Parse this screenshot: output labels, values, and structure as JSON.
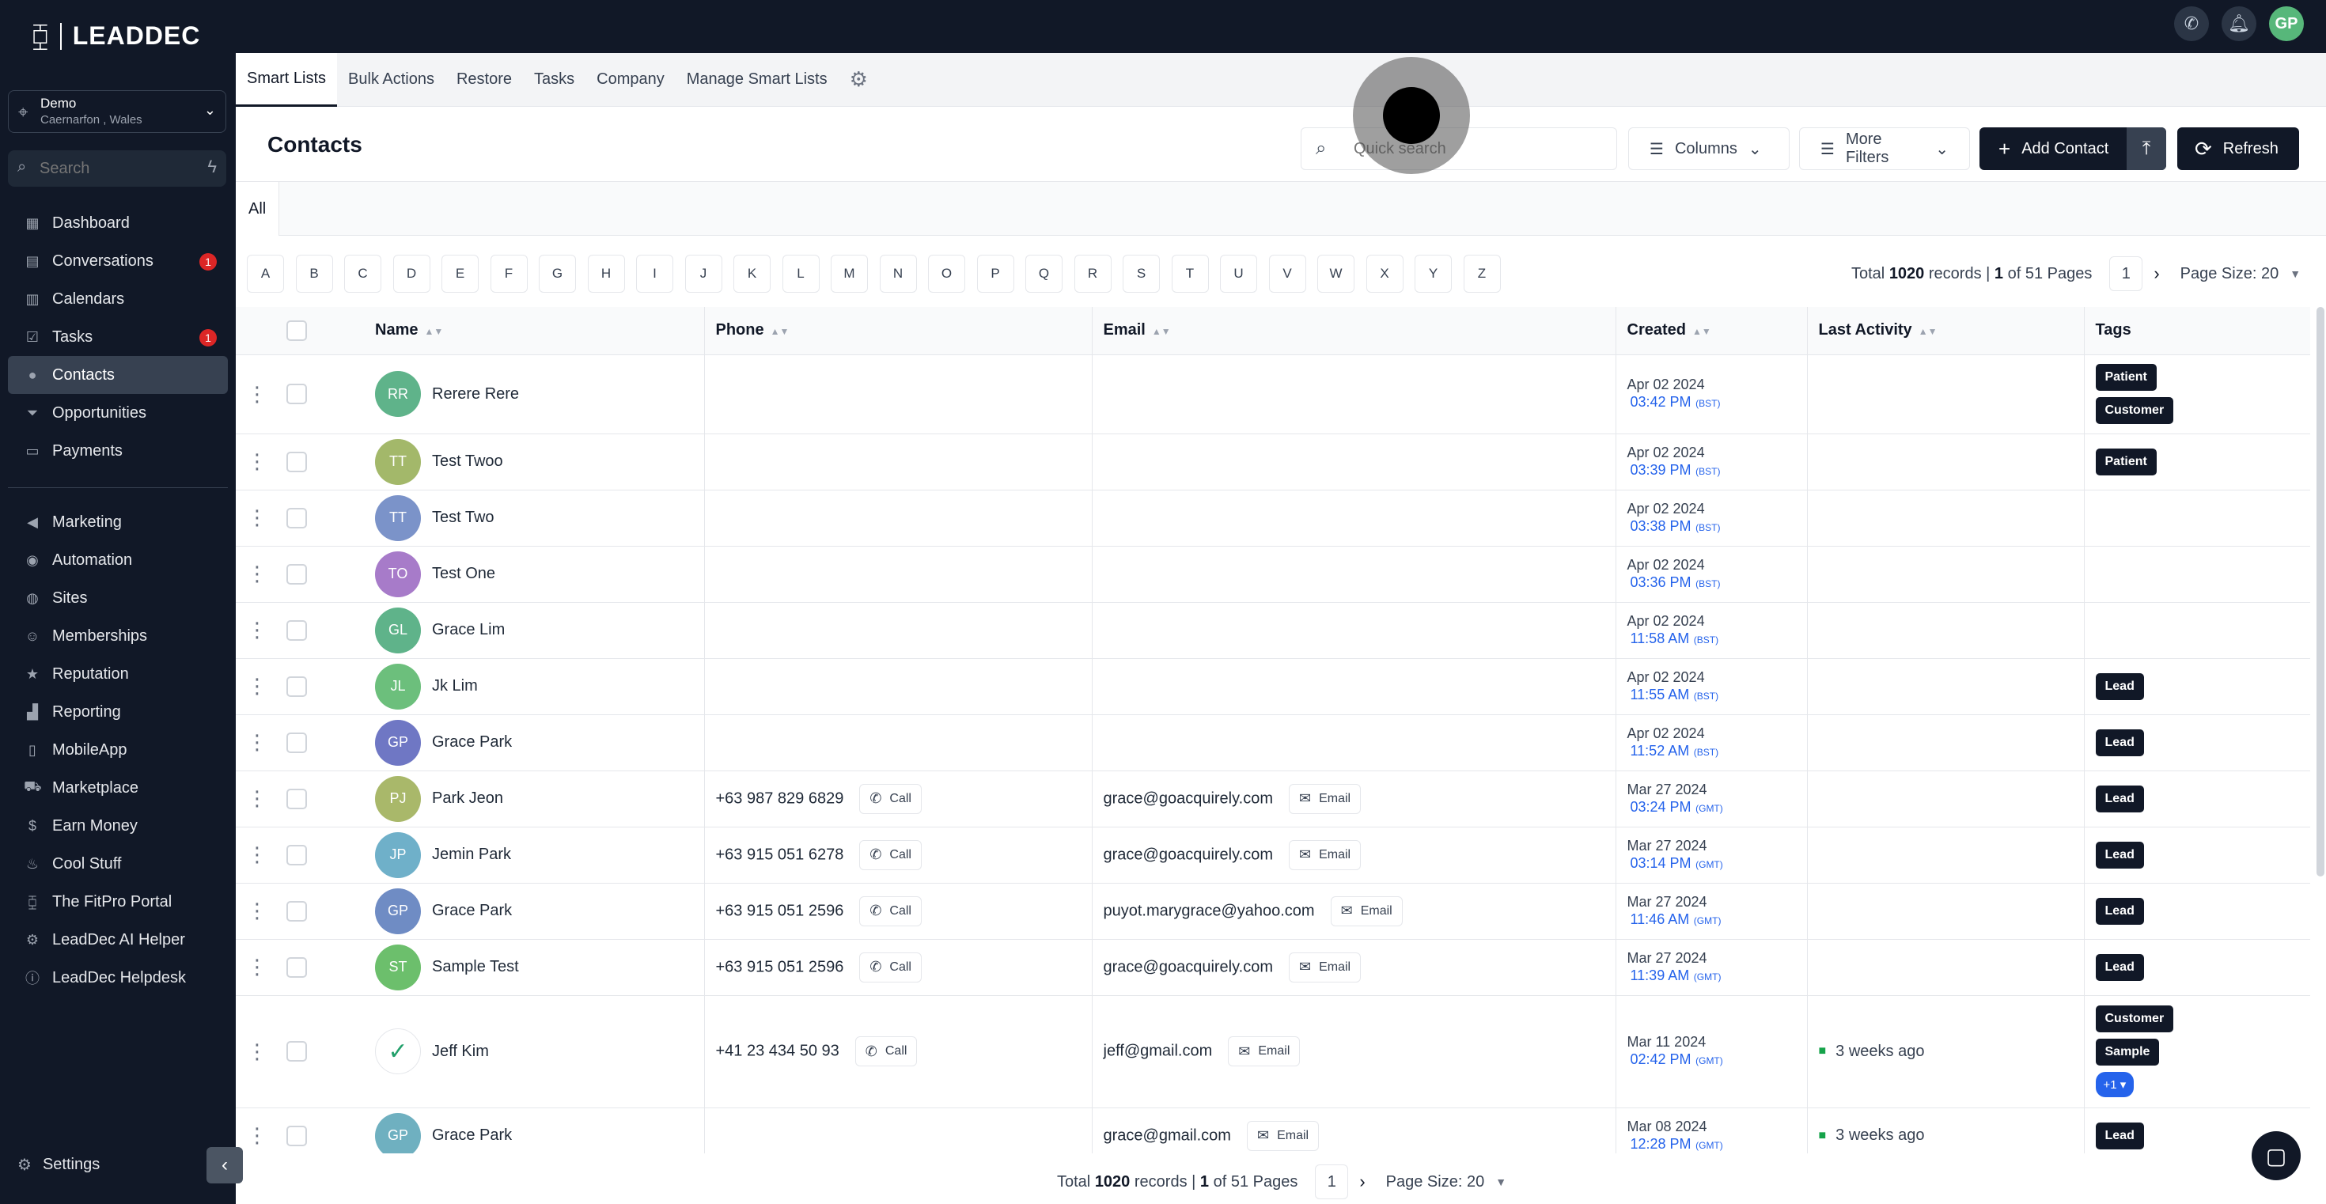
{
  "brand": {
    "name": "LEADDEC"
  },
  "location": {
    "name": "Demo",
    "sub": "Caernarfon , Wales"
  },
  "sidebar_search": {
    "placeholder": "Search"
  },
  "nav_primary": [
    {
      "label": "Dashboard",
      "icon": "dashboard-icon",
      "glyph": "▦"
    },
    {
      "label": "Conversations",
      "icon": "chat-icon",
      "glyph": "▤",
      "badge": "1"
    },
    {
      "label": "Calendars",
      "icon": "calendar-icon",
      "glyph": "▥"
    },
    {
      "label": "Tasks",
      "icon": "task-check-icon",
      "glyph": "☑",
      "badge": "1"
    },
    {
      "label": "Contacts",
      "icon": "person-icon",
      "glyph": "●",
      "active": true
    },
    {
      "label": "Opportunities",
      "icon": "funnel-icon",
      "glyph": "⏷"
    },
    {
      "label": "Payments",
      "icon": "card-icon",
      "glyph": "▭"
    }
  ],
  "nav_secondary": [
    {
      "label": "Marketing",
      "icon": "megaphone-icon",
      "glyph": "◀"
    },
    {
      "label": "Automation",
      "icon": "automation-icon",
      "glyph": "◉"
    },
    {
      "label": "Sites",
      "icon": "globe-icon",
      "glyph": "◍"
    },
    {
      "label": "Memberships",
      "icon": "people-icon",
      "glyph": "☺"
    },
    {
      "label": "Reputation",
      "icon": "star-icon",
      "glyph": "★"
    },
    {
      "label": "Reporting",
      "icon": "chart-icon",
      "glyph": "▟"
    },
    {
      "label": "MobileApp",
      "icon": "phone-icon",
      "glyph": "▯"
    },
    {
      "label": "Marketplace",
      "icon": "cart-icon",
      "glyph": "⛟"
    },
    {
      "label": "Earn Money",
      "icon": "money-icon",
      "glyph": "$"
    },
    {
      "label": "Cool Stuff",
      "icon": "flame-icon",
      "glyph": "♨"
    },
    {
      "label": "The FitPro Portal",
      "icon": "dumbbell-icon",
      "glyph": "⧮"
    },
    {
      "label": "LeadDec AI Helper",
      "icon": "robot-icon",
      "glyph": "⚙"
    },
    {
      "label": "LeadDec Helpdesk",
      "icon": "info-icon",
      "glyph": "ⓘ"
    }
  ],
  "settings_label": "Settings",
  "top_tabs": [
    "Smart Lists",
    "Bulk Actions",
    "Restore",
    "Tasks",
    "Company",
    "Manage Smart Lists"
  ],
  "page_title": "Contacts",
  "quick_search": {
    "placeholder": "Quick search"
  },
  "buttons": {
    "columns": "Columns",
    "more_filters": "More Filters",
    "add_contact": "Add Contact",
    "refresh": "Refresh"
  },
  "filter_tab": "All",
  "letters": [
    "A",
    "B",
    "C",
    "D",
    "E",
    "F",
    "G",
    "H",
    "I",
    "J",
    "K",
    "L",
    "M",
    "N",
    "O",
    "P",
    "Q",
    "R",
    "S",
    "T",
    "U",
    "V",
    "W",
    "X",
    "Y",
    "Z"
  ],
  "pagination": {
    "prefix": "Total",
    "total": "1020",
    "records": "records |",
    "page": "1",
    "of_pages": "of 51 Pages",
    "current": "1",
    "page_size": "Page Size: 20"
  },
  "columns": {
    "name": "Name",
    "phone": "Phone",
    "email": "Email",
    "created": "Created",
    "last_activity": "Last Activity",
    "tags": "Tags"
  },
  "call_label": "Call",
  "email_label": "Email",
  "contacts": [
    {
      "initials": "RR",
      "name": "Rerere Rere",
      "color": "#5fb38a",
      "phone": "",
      "email": "",
      "date": "Apr 02 2024",
      "time": "03:42 PM",
      "tz": "(BST)",
      "activity": "",
      "tags": [
        "Patient",
        "Customer"
      ],
      "more": ""
    },
    {
      "initials": "TT",
      "name": "Test Twoo",
      "color": "#a3b86a",
      "phone": "",
      "email": "",
      "date": "Apr 02 2024",
      "time": "03:39 PM",
      "tz": "(BST)",
      "activity": "",
      "tags": [
        "Patient"
      ],
      "more": ""
    },
    {
      "initials": "TT",
      "name": "Test Two",
      "color": "#7b93c9",
      "phone": "",
      "email": "",
      "date": "Apr 02 2024",
      "time": "03:38 PM",
      "tz": "(BST)",
      "activity": "",
      "tags": [],
      "more": ""
    },
    {
      "initials": "TO",
      "name": "Test One",
      "color": "#a77bc9",
      "phone": "",
      "email": "",
      "date": "Apr 02 2024",
      "time": "03:36 PM",
      "tz": "(BST)",
      "activity": "",
      "tags": [],
      "more": ""
    },
    {
      "initials": "GL",
      "name": "Grace Lim",
      "color": "#5fb38a",
      "phone": "",
      "email": "",
      "date": "Apr 02 2024",
      "time": "11:58 AM",
      "tz": "(BST)",
      "activity": "",
      "tags": [],
      "more": ""
    },
    {
      "initials": "JL",
      "name": "Jk Lim",
      "color": "#6cbf7c",
      "phone": "",
      "email": "",
      "date": "Apr 02 2024",
      "time": "11:55 AM",
      "tz": "(BST)",
      "activity": "",
      "tags": [
        "Lead"
      ],
      "more": ""
    },
    {
      "initials": "GP",
      "name": "Grace Park",
      "color": "#6f77c4",
      "phone": "",
      "email": "",
      "date": "Apr 02 2024",
      "time": "11:52 AM",
      "tz": "(BST)",
      "activity": "",
      "tags": [
        "Lead"
      ],
      "more": ""
    },
    {
      "initials": "PJ",
      "name": "Park Jeon",
      "color": "#a9b86a",
      "phone": "+63 987 829 6829",
      "email": "grace@goacquirely.com",
      "date": "Mar 27 2024",
      "time": "03:24 PM",
      "tz": "(GMT)",
      "activity": "",
      "tags": [
        "Lead"
      ],
      "more": ""
    },
    {
      "initials": "JP",
      "name": "Jemin Park",
      "color": "#6fb0c9",
      "phone": "+63 915 051 6278",
      "email": "grace@goacquirely.com",
      "date": "Mar 27 2024",
      "time": "03:14 PM",
      "tz": "(GMT)",
      "activity": "",
      "tags": [
        "Lead"
      ],
      "more": ""
    },
    {
      "initials": "GP",
      "name": "Grace Park",
      "color": "#6f8cc4",
      "phone": "+63 915 051 2596",
      "email": "puyot.marygrace@yahoo.com",
      "date": "Mar 27 2024",
      "time": "11:46 AM",
      "tz": "(GMT)",
      "activity": "",
      "tags": [
        "Lead"
      ],
      "more": ""
    },
    {
      "initials": "ST",
      "name": "Sample Test",
      "color": "#6cbf6c",
      "phone": "+63 915 051 2596",
      "email": "grace@goacquirely.com",
      "date": "Mar 27 2024",
      "time": "11:39 AM",
      "tz": "(GMT)",
      "activity": "",
      "tags": [
        "Lead"
      ],
      "more": ""
    },
    {
      "initials": "",
      "name": "Jeff Kim",
      "color": "#ffffff",
      "logo": true,
      "phone": "+41 23 434 50 93",
      "email": "jeff@gmail.com",
      "date": "Mar 11 2024",
      "time": "02:42 PM",
      "tz": "(GMT)",
      "activity": "3 weeks ago",
      "tags": [
        "Customer",
        "Sample"
      ],
      "more": "+1"
    },
    {
      "initials": "GP",
      "name": "Grace Park",
      "color": "#6fb0c0",
      "phone": "",
      "email": "grace@gmail.com",
      "date": "Mar 08 2024",
      "time": "12:28 PM",
      "tz": "(GMT)",
      "activity": "3 weeks ago",
      "tags": [
        "Lead"
      ],
      "more": ""
    }
  ],
  "user_initials": "GP",
  "colors": {
    "sidebar_bg": "#111827",
    "accent_blue": "#2563eb",
    "badge_red": "#dc2626",
    "tag_bg": "#111827"
  }
}
